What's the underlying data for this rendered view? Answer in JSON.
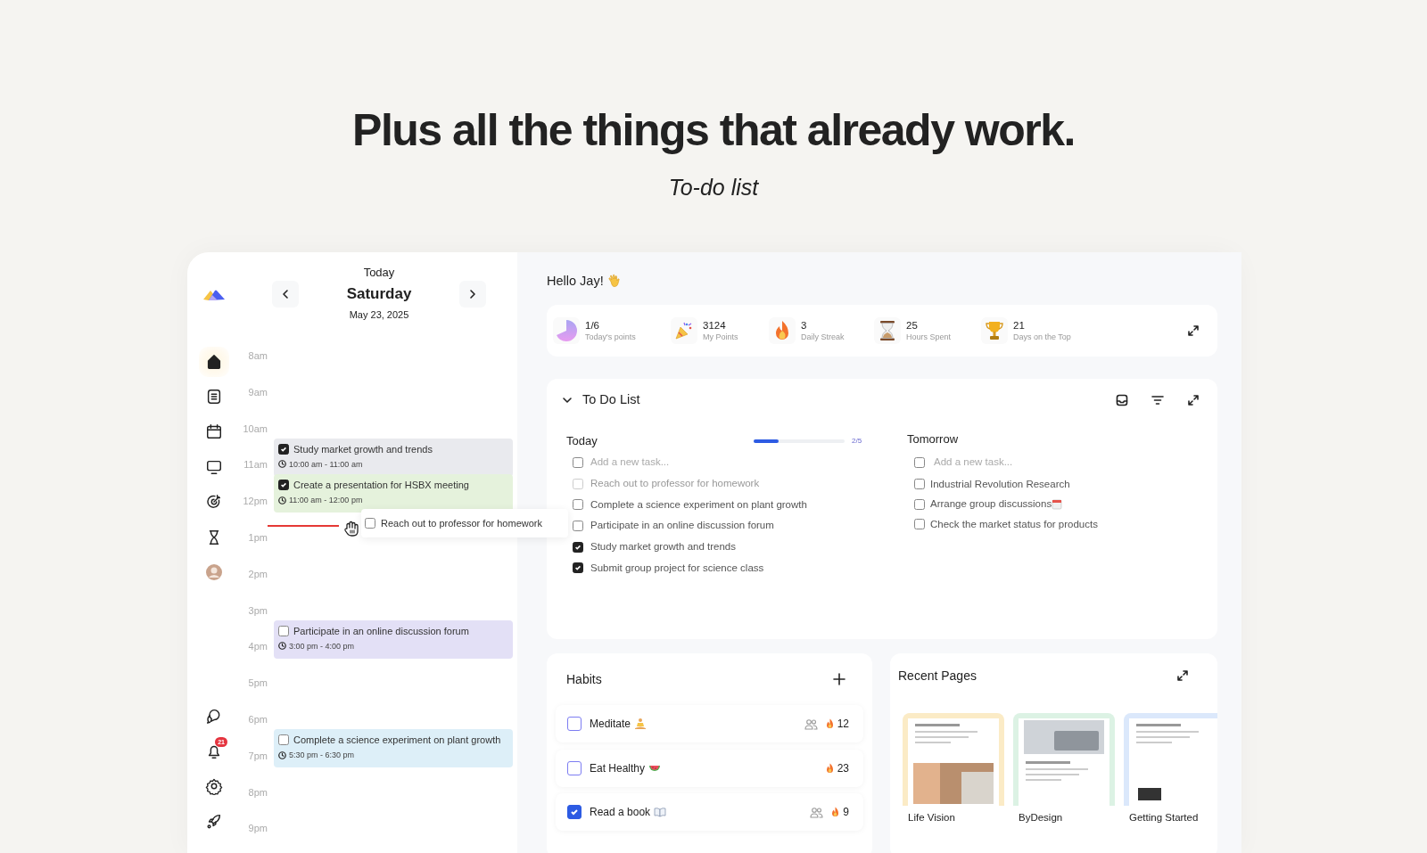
{
  "headline": "Plus all the things that already work.",
  "subtitle": "To-do list",
  "sidebar": {
    "top_items": [
      {
        "kind": "home",
        "selected": true
      },
      {
        "kind": "notes",
        "selected": false
      },
      {
        "kind": "calendar",
        "selected": false
      },
      {
        "kind": "monitor",
        "selected": false
      },
      {
        "kind": "target",
        "selected": false
      },
      {
        "kind": "hourglass",
        "selected": false
      },
      {
        "kind": "avatar",
        "selected": false
      }
    ],
    "bottom_items": [
      {
        "kind": "chat",
        "selected": false
      },
      {
        "kind": "bell",
        "selected": false,
        "badge": "21"
      },
      {
        "kind": "settings",
        "selected": false
      },
      {
        "kind": "rocket",
        "selected": false
      }
    ]
  },
  "calendar": {
    "label": "Today",
    "day": "Saturday",
    "date": "May 23, 2025",
    "hours": [
      {
        "label": "8am"
      },
      {
        "label": "9am"
      },
      {
        "label": "10am",
        "events": [
          {
            "title": "Study market growth and trends",
            "time": "10:00 am - 11:00 am",
            "checked": true,
            "color": "#e9eaee"
          }
        ]
      },
      {
        "label": "11am",
        "events": [
          {
            "title": "Create a presentation for HSBX meeting",
            "time": "11:00 am - 12:00 pm",
            "checked": true,
            "color": "#e5f2dc"
          }
        ]
      },
      {
        "label": "12pm",
        "dragged_task": {
          "title": "Reach out to professor for homework",
          "checked": false
        }
      },
      {
        "label": "1pm"
      },
      {
        "label": "2pm"
      },
      {
        "label": "3pm",
        "events": [
          {
            "title": "Participate in an online discussion forum",
            "time": "3:00 pm - 4:00 pm",
            "checked": false,
            "color": "#e3e0f6"
          }
        ]
      },
      {
        "label": "4pm"
      },
      {
        "label": "5pm"
      },
      {
        "label": "6pm",
        "events": [
          {
            "title": "Complete a science experiment on plant growth",
            "time": "5:30 pm - 6:30 pm",
            "checked": false,
            "color": "#ddeff8"
          }
        ]
      },
      {
        "label": "7pm"
      },
      {
        "label": "8pm"
      },
      {
        "label": "9pm"
      }
    ]
  },
  "greeting": {
    "text": "Hello Jay!"
  },
  "stats": [
    {
      "value": "1/6",
      "label": "Today's points"
    },
    {
      "value": "3124",
      "label": "My Points"
    },
    {
      "value": "3",
      "label": "Daily Streak"
    },
    {
      "value": "25",
      "label": "Hours Spent"
    },
    {
      "value": "21",
      "label": "Days on the Top"
    }
  ],
  "todo": {
    "title": "To Do List",
    "expanded": true,
    "today": {
      "title": "Today",
      "level": 0.27,
      "reading": "2/5",
      "new_task": {
        "placeholder": "Add a new task...",
        "checked": false
      },
      "tasks": [
        {
          "text": "Reach out to professor for homework",
          "checked": false,
          "dragging": true
        },
        {
          "text": "Complete a science experiment on plant growth",
          "checked": false,
          "dragging": false
        },
        {
          "text": "Participate in an online discussion forum",
          "checked": false,
          "dragging": false
        },
        {
          "text": "Study market growth and trends",
          "checked": true,
          "dragging": false
        },
        {
          "text": "Submit group project for science class",
          "checked": true,
          "dragging": false
        }
      ]
    },
    "tomorrow": {
      "title": "Tomorrow",
      "new_task": {
        "placeholder": "Add a new task...",
        "checked": false
      },
      "tasks": [
        {
          "text": "Industrial Revolution Research",
          "checked": false
        },
        {
          "text": "Arrange group discussions",
          "checked": false
        },
        {
          "text": "Check the market status for products",
          "checked": false
        }
      ]
    }
  },
  "habits": {
    "title": "Habits",
    "items": [
      {
        "name": "Meditate",
        "checked": false,
        "shared": true,
        "streak": "12"
      },
      {
        "name": "Eat Healthy",
        "checked": false,
        "shared": false,
        "streak": "23"
      },
      {
        "name": "Read a book",
        "checked": true,
        "shared": true,
        "streak": "9"
      }
    ]
  },
  "recent": {
    "title": "Recent Pages",
    "pages": [
      {
        "title": "Life Vision",
        "color": "#fbebc6",
        "kind": "picture"
      },
      {
        "title": "ByDesign",
        "color": "#dcf2e4",
        "kind": "picture"
      },
      {
        "title": "Getting Started",
        "color": "#dbe8fb",
        "kind": "picture"
      }
    ]
  }
}
